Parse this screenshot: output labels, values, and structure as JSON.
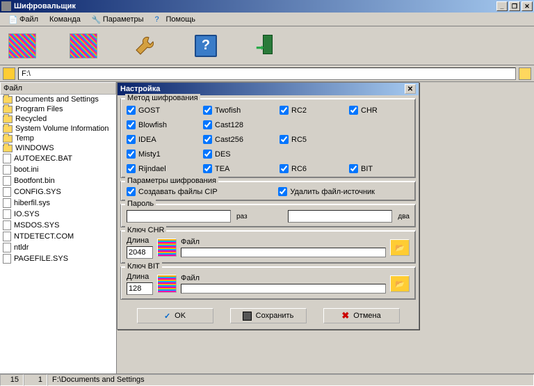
{
  "window": {
    "title": "Шифровальщик"
  },
  "menu": {
    "file": "Файл",
    "command": "Команда",
    "params": "Параметры",
    "help": "Помощь"
  },
  "path": {
    "value": "F:\\"
  },
  "filelist": {
    "header": "Файл",
    "items": [
      {
        "name": "Documents and Settings",
        "type": "folder"
      },
      {
        "name": "Program Files",
        "type": "folder"
      },
      {
        "name": "Recycled",
        "type": "folder"
      },
      {
        "name": "System Volume Information",
        "type": "folder"
      },
      {
        "name": "Temp",
        "type": "folder"
      },
      {
        "name": "WINDOWS",
        "type": "folder"
      },
      {
        "name": "AUTOEXEC.BAT",
        "type": "file"
      },
      {
        "name": "boot.ini",
        "type": "file"
      },
      {
        "name": "Bootfont.bin",
        "type": "file"
      },
      {
        "name": "CONFIG.SYS",
        "type": "file"
      },
      {
        "name": "hiberfil.sys",
        "type": "file"
      },
      {
        "name": "IO.SYS",
        "type": "file"
      },
      {
        "name": "MSDOS.SYS",
        "type": "file"
      },
      {
        "name": "NTDETECT.COM",
        "type": "file"
      },
      {
        "name": "ntldr",
        "type": "file"
      },
      {
        "name": "PAGEFILE.SYS",
        "type": "file"
      }
    ]
  },
  "dialog": {
    "title": "Настройка",
    "group_method": "Метод шифрования",
    "ciphers": {
      "gost": "GOST",
      "twofish": "Twofish",
      "rc2": "RC2",
      "chr": "CHR",
      "blowfish": "Blowfish",
      "cast128": "Cast128",
      "idea": "IDEA",
      "cast256": "Cast256",
      "rc5": "RC5",
      "misty1": "Misty1",
      "des": "DES",
      "rijndael": "Rijndael",
      "tea": "TEA",
      "rc6": "RC6",
      "bit": "BIT"
    },
    "group_params": "Параметры шифрования",
    "create_cip": "Создавать файлы CIP",
    "delete_src": "Удалить файл-источник",
    "group_pwd": "Пароль",
    "pwd_once": "раз",
    "pwd_twice": "два",
    "group_chr": "Ключ CHR",
    "len_label": "Длина",
    "file_label": "Файл",
    "chr_len": "2048",
    "group_bit": "Ключ BIT",
    "bit_len": "128",
    "btn_ok": "OK",
    "btn_save": "Сохранить",
    "btn_cancel": "Отмена"
  },
  "status": {
    "col1": "15",
    "col2": "1",
    "path": "F:\\Documents and Settings"
  }
}
